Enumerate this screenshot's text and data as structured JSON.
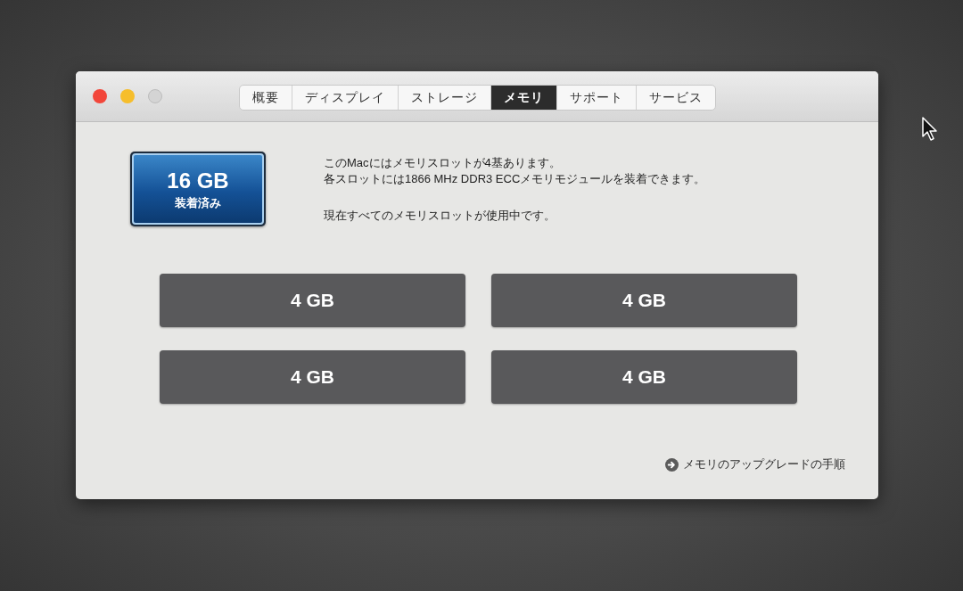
{
  "window": {
    "controls": [
      {
        "kind": "close",
        "disabled": false
      },
      {
        "kind": "minimize",
        "disabled": false
      },
      {
        "kind": "zoom",
        "disabled": true
      }
    ]
  },
  "tabs": [
    {
      "label": "概要",
      "selected": false
    },
    {
      "label": "ディスプレイ",
      "selected": false
    },
    {
      "label": "ストレージ",
      "selected": false
    },
    {
      "label": "メモリ",
      "selected": true
    },
    {
      "label": "サポート",
      "selected": false
    },
    {
      "label": "サービス",
      "selected": false
    }
  ],
  "memory_badge": {
    "size": "16 GB",
    "label": "装着済み"
  },
  "description": [
    "このMacにはメモリスロットが4基あります。",
    "各スロットには1866 MHz DDR3 ECCメモリモジュールを装着できます。"
  ],
  "status": "現在すべてのメモリスロットが使用中です。",
  "slots": [
    {
      "size": "4 GB"
    },
    {
      "size": "4 GB"
    },
    {
      "size": "4 GB"
    },
    {
      "size": "4 GB"
    }
  ],
  "upgrade_link": {
    "label": "メモリのアップグレードの手順"
  }
}
